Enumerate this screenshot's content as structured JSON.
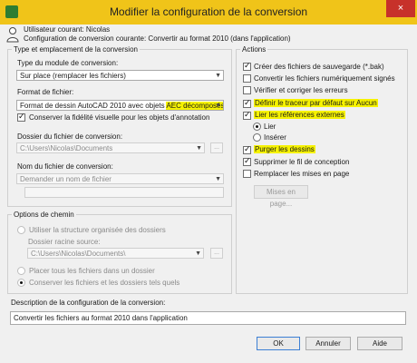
{
  "window": {
    "title": "Modifier la configuration de la conversion",
    "close_glyph": "×"
  },
  "user": {
    "current_user": "Utilisateur courant: Nicolas",
    "current_config": "Configuration de conversion courante: Convertir au format 2010 (dans l'application)"
  },
  "left_group": {
    "legend": "Type et emplacement de la conversion",
    "module_type_label": "Type du module de conversion:",
    "module_type_value": "Sur place (remplacer les fichiers)",
    "file_format_label": "Format de fichier:",
    "file_format_value_a": "Format de dessin AutoCAD 2010 avec objets ",
    "file_format_value_b": "AEC décomposés",
    "keep_fidelity": "Conserver la fidélité visuelle pour les objets d'annotation",
    "folder_label": "Dossier du fichier de conversion:",
    "folder_value": "C:\\Users\\Nicolas\\Documents",
    "browse_glyph": "...",
    "filename_label": "Nom du fichier de conversion:",
    "filename_value": "Demander un nom de fichier"
  },
  "path_group": {
    "legend": "Options de chemin",
    "use_structure": "Utiliser la structure organisée des dossiers",
    "root_folder_label": "Dossier racine source:",
    "root_folder_value": "C:\\Users\\Nicolas\\Documents\\",
    "place_all": "Placer tous les fichiers dans un dossier",
    "keep_folders": "Conserver les fichiers et les dossiers tels quels"
  },
  "actions": {
    "legend": "Actions",
    "items": [
      {
        "label": "Créer des fichiers de sauvegarde (*.bak)",
        "checked": true
      },
      {
        "label": "Convertir les fichiers numériquement signés",
        "checked": false
      },
      {
        "label": "Vérifier et corriger les erreurs",
        "checked": false
      },
      {
        "label": "Définir le traceur par défaut sur Aucun",
        "checked": true
      },
      {
        "label": "Lier les références externes",
        "checked": true
      }
    ],
    "bind": "Lier",
    "insert": "Insérer",
    "purge": "Purger les dessins",
    "remove_thread": "Supprimer le fil de conception",
    "replace_layouts": "Remplacer les mises en page",
    "layouts_button": "Mises en page..."
  },
  "description": {
    "label": "Description de la configuration de la conversion:",
    "value": "Convertir les fichiers au format 2010 dans l'application"
  },
  "buttons": {
    "ok": "OK",
    "cancel": "Annuler",
    "help": "Aide"
  },
  "colors": {
    "titlebar": "#f0c419",
    "highlight": "#f6f200",
    "close": "#c7312a"
  }
}
